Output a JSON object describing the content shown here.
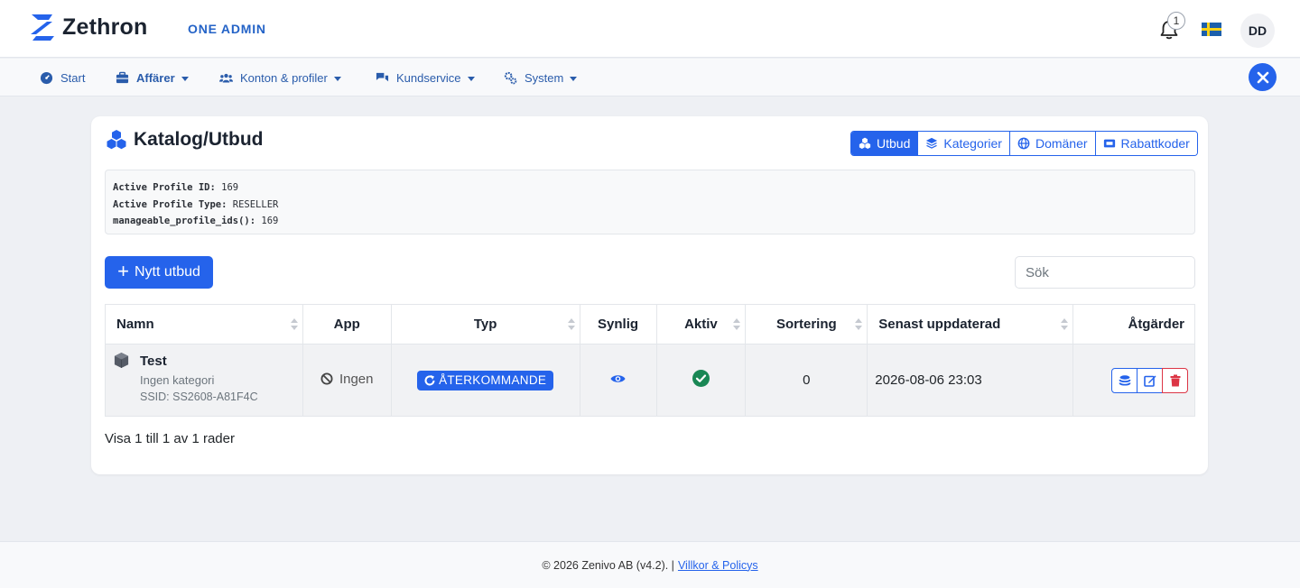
{
  "brand": {
    "name": "Zethron",
    "admin_label": "ONE ADMIN",
    "accent": "#2563eb"
  },
  "header": {
    "notifications_count": "1",
    "language_flag": "swedish-flag",
    "user_initials": "DD"
  },
  "nav": {
    "items": [
      {
        "label": "Start",
        "icon": "dashboard-icon",
        "dropdown": false
      },
      {
        "label": "Affärer",
        "icon": "briefcase-icon",
        "dropdown": true
      },
      {
        "label": "Konton & profiler",
        "icon": "users-icon",
        "dropdown": true
      },
      {
        "label": "Kundservice",
        "icon": "chat-icon",
        "dropdown": true
      },
      {
        "label": "System",
        "icon": "cogs-icon",
        "dropdown": true
      }
    ]
  },
  "page": {
    "title": "Katalog/Utbud",
    "segments": [
      {
        "label": "Utbud",
        "icon": "cubes-icon",
        "active": true
      },
      {
        "label": "Kategorier",
        "icon": "layers-icon",
        "active": false
      },
      {
        "label": "Domäner",
        "icon": "globe-icon",
        "active": false
      },
      {
        "label": "Rabattkoder",
        "icon": "ticket-icon",
        "active": false
      }
    ],
    "debug": [
      {
        "key": "Active Profile ID:",
        "value": "169"
      },
      {
        "key": "Active Profile Type:",
        "value": "RESELLER"
      },
      {
        "key": "manageable_profile_ids():",
        "value": "169"
      }
    ],
    "new_button_label": "Nytt utbud",
    "search_placeholder": "Sök"
  },
  "table": {
    "columns": [
      "Namn",
      "App",
      "Typ",
      "Synlig",
      "Aktiv",
      "Sortering",
      "Senast uppdaterad",
      "Åtgärder"
    ],
    "rows": [
      {
        "name": "Test",
        "category": "Ingen kategori",
        "ssid": "SSID: SS2608-A81F4C",
        "app": "Ingen",
        "type": "ÅTERKOMMANDE",
        "visible": true,
        "active": true,
        "sort": "0",
        "updated": "2026-08-06 23:03"
      }
    ],
    "rows_info": "Visa 1 till 1 av 1 rader"
  },
  "footer": {
    "copyright": "© 2026 Zenivo AB (v4.2). |",
    "link_label": "Villkor & Policys"
  }
}
